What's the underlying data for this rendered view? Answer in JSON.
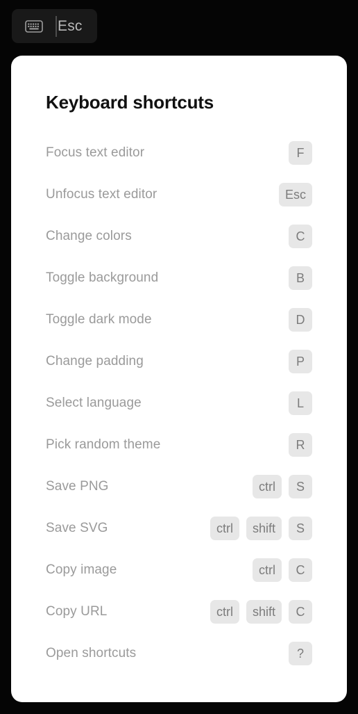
{
  "top_bar": {
    "esc_button": {
      "icon": "keyboard-icon",
      "label": "Esc"
    }
  },
  "modal": {
    "title": "Keyboard shortcuts",
    "shortcuts": [
      {
        "action": "Focus text editor",
        "keys": [
          "F"
        ]
      },
      {
        "action": "Unfocus text editor",
        "keys": [
          "Esc"
        ]
      },
      {
        "action": "Change colors",
        "keys": [
          "C"
        ]
      },
      {
        "action": "Toggle background",
        "keys": [
          "B"
        ]
      },
      {
        "action": "Toggle dark mode",
        "keys": [
          "D"
        ]
      },
      {
        "action": "Change padding",
        "keys": [
          "P"
        ]
      },
      {
        "action": "Select language",
        "keys": [
          "L"
        ]
      },
      {
        "action": "Pick random theme",
        "keys": [
          "R"
        ]
      },
      {
        "action": "Save PNG",
        "keys": [
          "ctrl",
          "S"
        ]
      },
      {
        "action": "Save SVG",
        "keys": [
          "ctrl",
          "shift",
          "S"
        ]
      },
      {
        "action": "Copy image",
        "keys": [
          "ctrl",
          "C"
        ]
      },
      {
        "action": "Copy URL",
        "keys": [
          "ctrl",
          "shift",
          "C"
        ]
      },
      {
        "action": "Open shortcuts",
        "keys": [
          "?"
        ]
      }
    ]
  },
  "colors": {
    "page_background": "#050505",
    "button_background": "#191919",
    "modal_background": "#ffffff",
    "title_text": "#111111",
    "label_text": "#9a9a9a",
    "key_badge_background": "#e7e7e7",
    "key_badge_text": "#7c7c7c"
  }
}
